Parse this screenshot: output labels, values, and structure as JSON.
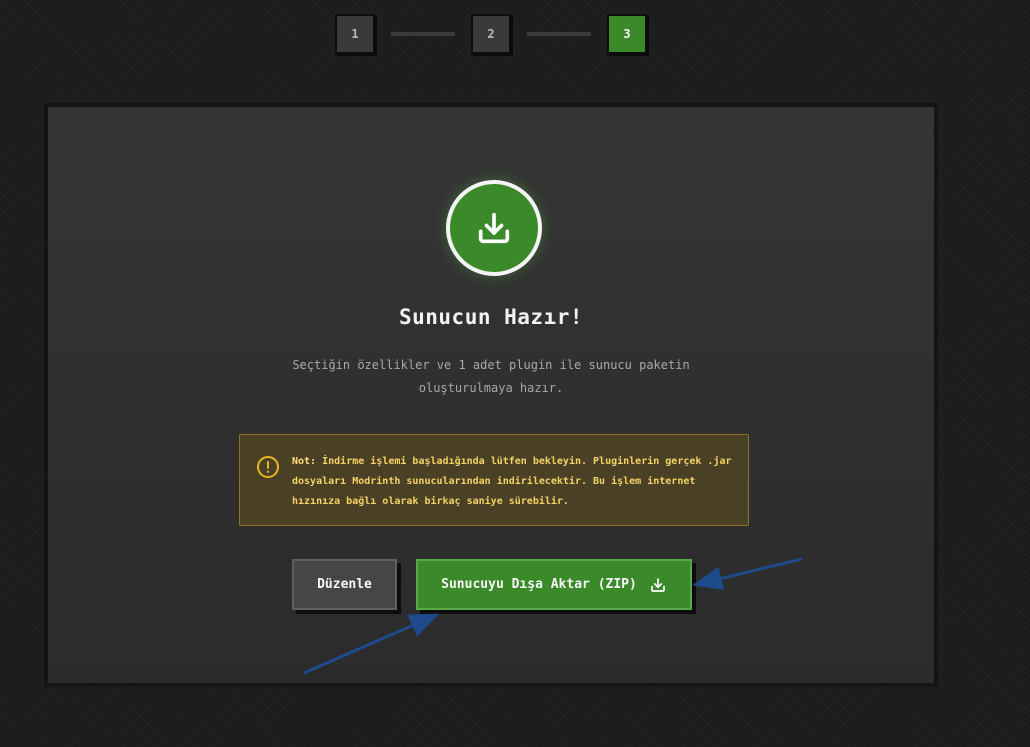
{
  "stepper": {
    "steps": [
      {
        "label": "1"
      },
      {
        "label": "2"
      },
      {
        "label": "3"
      }
    ],
    "active_color": "#3b8a2a",
    "inactive_color": "#3a3a3a"
  },
  "card": {
    "icon": "download-icon",
    "title": "Sunucun Hazır!",
    "subtitle": "Seçtiğin özellikler ve 1 adet plugin ile sunucu paketin oluşturulmaya hazır.",
    "note": {
      "icon": "alert-circle-icon",
      "label": "Not:",
      "text": " İndirme işlemi başladığında lütfen bekleyin. Pluginlerin gerçek .jar dosyaları Modrinth sunucularından indirilecektir. Bu işlem internet hızınıza bağlı olarak birkaç saniye sürebilir."
    },
    "buttons": {
      "edit_label": "Düzenle",
      "export_label": "Sunucuyu Dışa Aktar (ZIP)",
      "export_icon": "download-icon"
    }
  },
  "colors": {
    "accent": "#3b8a2a",
    "note_bg": "#4a4026",
    "note_text": "#f4d266",
    "annotation_arrow": "#1d4a8a"
  }
}
